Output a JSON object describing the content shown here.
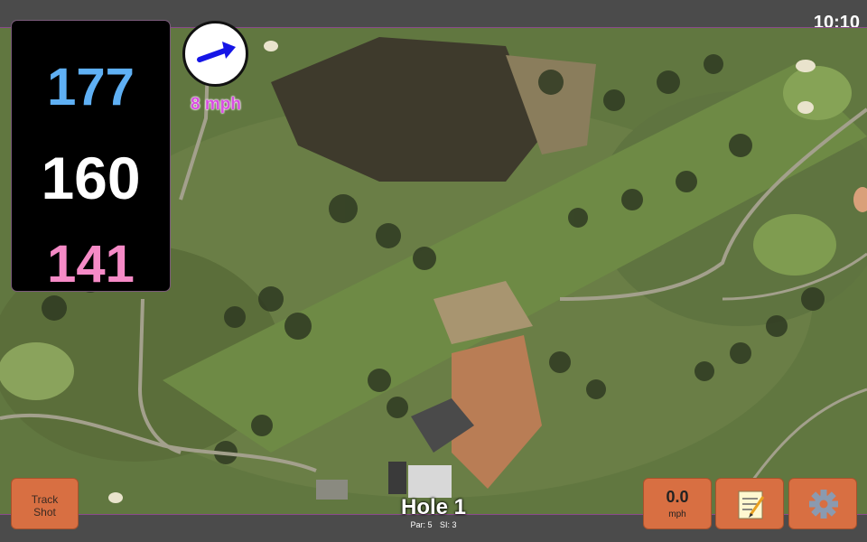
{
  "status_bar": {
    "time": "10:10"
  },
  "distances": {
    "back": "177",
    "middle": "160",
    "front": "141"
  },
  "wind": {
    "speed_label": "8 mph",
    "direction_icon": "arrow-icon"
  },
  "buttons": {
    "track_shot_line1": "Track",
    "track_shot_line2": "Shot",
    "speed_value": "0.0",
    "speed_unit": "mph",
    "notes_icon": "notepad-icon",
    "settings_icon": "gear-icon"
  },
  "hole": {
    "title": "Hole 1",
    "par": "Par: 5",
    "si": "SI: 3"
  },
  "colors": {
    "back": "#5fb0f4",
    "middle": "#ffffff",
    "front": "#f58ac6",
    "wind_text": "#d84fe0",
    "button": "#d86f42"
  }
}
